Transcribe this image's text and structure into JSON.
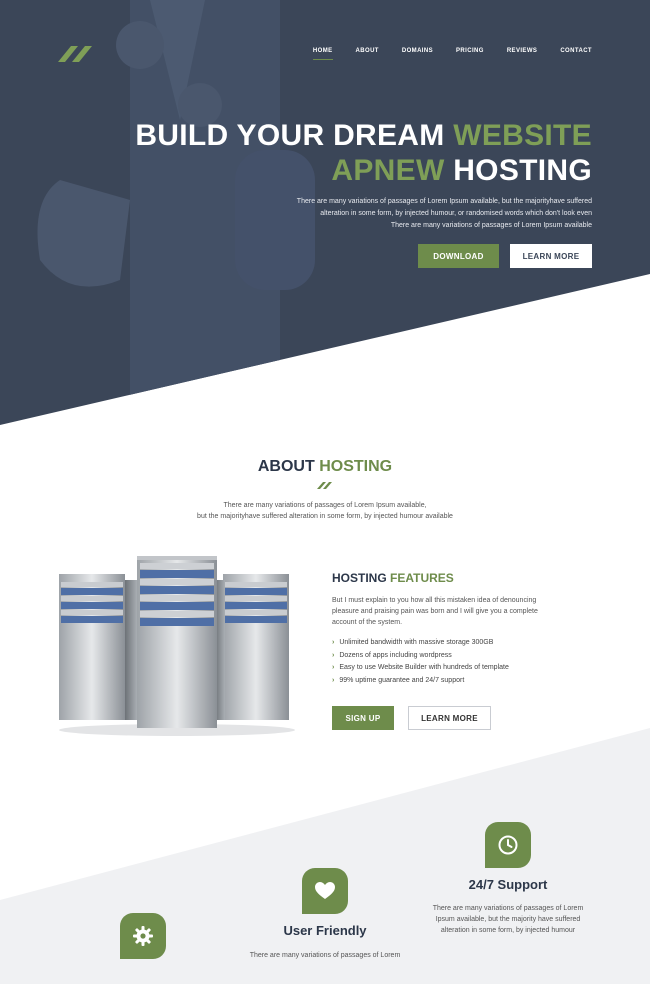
{
  "nav": {
    "items": [
      "HOME",
      "ABOUT",
      "DOMAINS",
      "PRICING",
      "REVIEWS",
      "CONTACT"
    ]
  },
  "hero": {
    "title_line1_a": "BUILD YOUR DREAM",
    "title_line1_b": "WEBSITE",
    "title_line2_a": "APNEW",
    "title_line2_b": "HOSTING",
    "text_line1": "There are many variations of passages of Lorem Ipsum available, but the majorityhave suffered",
    "text_line2": "alteration in some form, by injected humour, or randomised words which don't look even",
    "text_line3": "There are many variations of passages of Lorem Ipsum available",
    "download_label": "DOWNLOAD",
    "learn_more_label": "LEARN MORE"
  },
  "about": {
    "title_a": "ABOUT",
    "title_b": "HOSTING",
    "text_line1": "There are many variations of passages of Lorem Ipsum available,",
    "text_line2": "but the majorityhave suffered alteration in some form, by injected humour available"
  },
  "features": {
    "title_a": "HOSTING",
    "title_b": "FEATURES",
    "text": "But I must explain to you how all this mistaken idea of denouncing pleasure and praising pain was born and I will give you a complete account of the system.",
    "items": [
      "Unlimited bandwidth with massive storage 300GB",
      "Dozens of apps including wordpress",
      "Easy to use Website Builder with hundreds of template",
      "99% uptime guarantee and 24/7 support"
    ],
    "signup_label": "SIGN UP",
    "learn_more_label": "LEARN MORE"
  },
  "services": [
    {
      "icon": "gear-icon",
      "title": "",
      "text": ""
    },
    {
      "icon": "heart-icon",
      "title": "User Friendly",
      "text": "There are many variations of passages of Lorem"
    },
    {
      "icon": "clock-icon",
      "title": "24/7 Support",
      "text": "There are many variations of passages of Lorem Ipsum available, but the majority have suffered alteration in some form, by injected humour"
    }
  ],
  "colors": {
    "accent": "#6e8c4b",
    "hero_bg": "#3b4658",
    "heading": "#2c3749"
  }
}
